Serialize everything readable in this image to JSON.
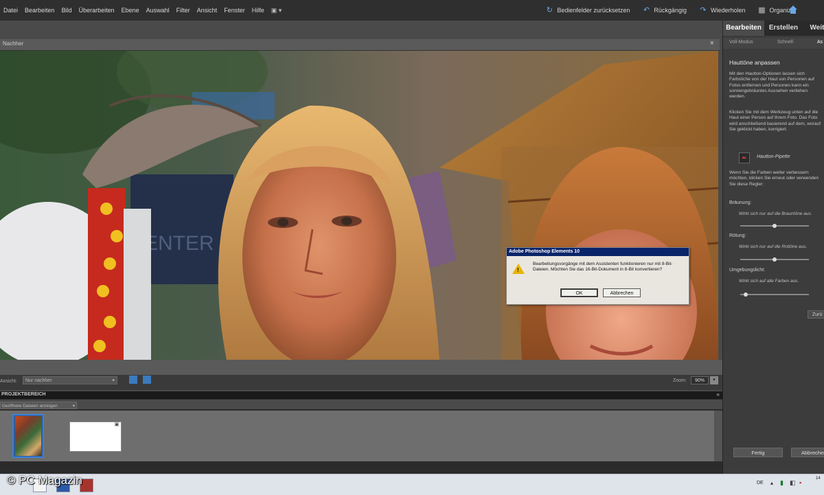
{
  "menubar": {
    "items": [
      "Datei",
      "Bearbeiten",
      "Bild",
      "Überarbeiten",
      "Ebene",
      "Auswahl",
      "Filter",
      "Ansicht",
      "Fenster",
      "Hilfe"
    ],
    "reset_panels": "Bedienfelder zurücksetzen",
    "undo": "Rückgängig",
    "redo": "Wiederholen",
    "organizer": "Organizer"
  },
  "document": {
    "title": "Nachher",
    "close": "×"
  },
  "dialog": {
    "title": "Adobe Photoshop Elements 10",
    "message": "Bearbeitungsvorgänge mit dem Assistenten funktionieren nur mit 8-Bit-Dateien. Möchten Sie das 16-Bit-Dokument in 8-Bit konvertieren?",
    "ok": "OK",
    "cancel": "Abbrechen"
  },
  "viewbar": {
    "label": "Ansicht:",
    "select": "Nur nachher",
    "zoom_label": "Zoom:",
    "zoom_value": "90%"
  },
  "bin": {
    "title": "PROJEKTBEREICH",
    "toggle": "«",
    "filter": "Geöffnete Dateien anzeigen"
  },
  "panel": {
    "tabs": [
      "Bearbeiten",
      "Erstellen",
      "Weit"
    ],
    "subtabs": [
      "Voll-Modus",
      "Schnell",
      "As"
    ],
    "heading": "Hauttöne anpassen",
    "intro": "Mit den Hautton-Optionen lassen sich Farbstiche von der Haut von Personen auf Fotos entfernen und Personen kann ein sonnengebräuntes Aussehen verliehen werden.",
    "instruction": "Klicken Sie mit dem Werkzeug unten auf die Haut einer Person auf Ihrem Foto. Das Foto wird anschließend basierend auf dem, worauf Sie geklickt haben, korrigiert.",
    "eyedropper": "Hautton-Pipette",
    "refine": "Wenn Sie die Farben weiter verbessern möchten, klicken Sie erneut oder verwenden Sie diese Regler:",
    "sliders": [
      {
        "label": "Bräunung:",
        "hint": "Wirkt sich nur auf die Brauntöne aus.",
        "value": 0.5
      },
      {
        "label": "Rötung:",
        "hint": "Wirkt sich nur auf die Rottöne aus.",
        "value": 0.5
      },
      {
        "label": "Umgebungslicht:",
        "hint": "Wirkt sich auf alle Farben aus.",
        "value": 0.05
      }
    ],
    "reset": "Zurü",
    "done": "Fertig",
    "cancel": "Abbrechen"
  },
  "taskbar": {
    "watermark": "© PC Magazin",
    "lang": "DE",
    "time": "14"
  }
}
